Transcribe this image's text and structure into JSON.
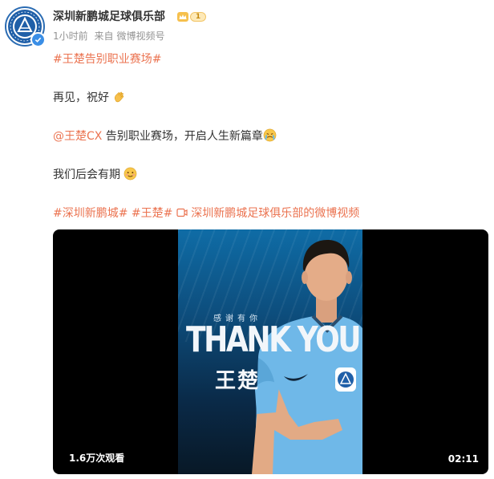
{
  "author": {
    "name": "深圳新鹏城足球俱乐部",
    "level": "1",
    "avatar_icon": "club-crest-icon",
    "verified_icon": "verified-check-icon"
  },
  "meta": {
    "time": "1小时前",
    "source_prefix": "来自",
    "source": "微博视频号"
  },
  "post": {
    "topic_headline": "#王楚告别职业赛场#",
    "line1": "再见，祝好",
    "line1_emoji": "waving-hand-icon",
    "mention": "@王楚CX",
    "line2": "告别职业赛场，开启人生新篇章",
    "line2_emoji": "crying-face-icon",
    "line3": "我们后会有期",
    "line3_emoji": "smiling-face-icon",
    "tags": [
      "#深圳新鹏城#",
      "#王楚#"
    ],
    "video_link": "深圳新鹏城足球俱乐部的微博视频"
  },
  "video": {
    "poster_subtitle": "感谢有你",
    "poster_title": "THANK YOU",
    "poster_name": "王楚",
    "views": "1.6万次观看",
    "duration": "02:11"
  },
  "colors": {
    "link": "#eb7350",
    "text": "#333333",
    "meta": "#939393",
    "verified": "#3a8ee6"
  }
}
